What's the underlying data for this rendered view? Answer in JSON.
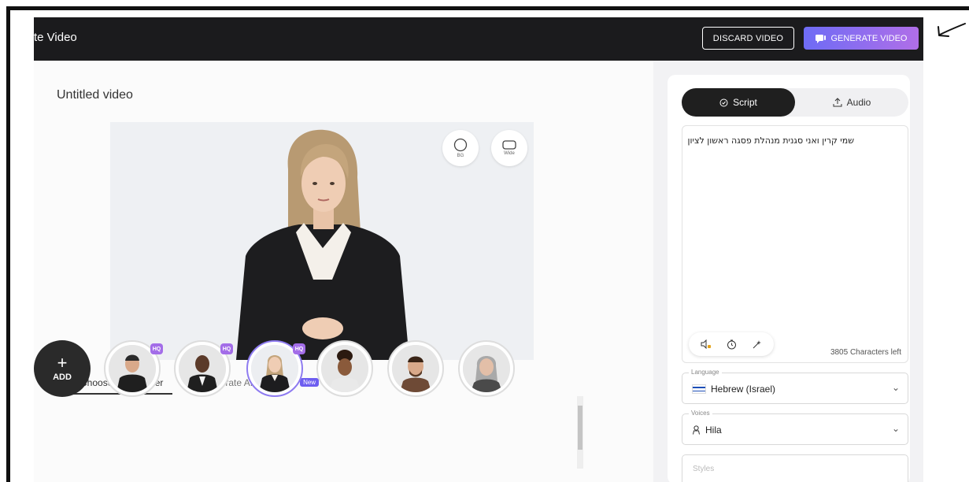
{
  "header": {
    "title": "te Video",
    "discard_label": "DISCARD VIDEO",
    "generate_label": "GENERATE VIDEO"
  },
  "editor": {
    "video_title": "Untitled video",
    "canvas_controls": [
      {
        "label": "BG",
        "icon": "circle-icon"
      },
      {
        "label": "Wide",
        "icon": "wide-frame-icon"
      }
    ],
    "tabs": {
      "presenter_label": "Choose a presenter",
      "ai_label": "Generate AI presenter",
      "ai_badge": "New"
    },
    "add_label": "ADD",
    "add_symbol": "+",
    "presenters": [
      {
        "hq": "HQ",
        "selected": false
      },
      {
        "hq": "HQ",
        "selected": false
      },
      {
        "hq": "HQ",
        "selected": true
      },
      {
        "hq": "",
        "selected": false
      },
      {
        "hq": "",
        "selected": false
      },
      {
        "hq": "",
        "selected": false
      }
    ]
  },
  "panel": {
    "script_tab": "Script",
    "audio_tab": "Audio",
    "script_text": "שמי קרין ואני סגנית מנהלת פסגה ראשון לציון",
    "chars_left": "3805 Characters left",
    "language_legend": "Language",
    "language_value": "Hebrew (Israel)",
    "voices_legend": "Voices",
    "voice_value": "Hila",
    "styles_legend": "Styles"
  },
  "colors": {
    "accent_start": "#6e6cf5",
    "accent_end": "#b06ee8",
    "topbar": "#1b1b1d",
    "hq_badge": "#a36de8"
  }
}
